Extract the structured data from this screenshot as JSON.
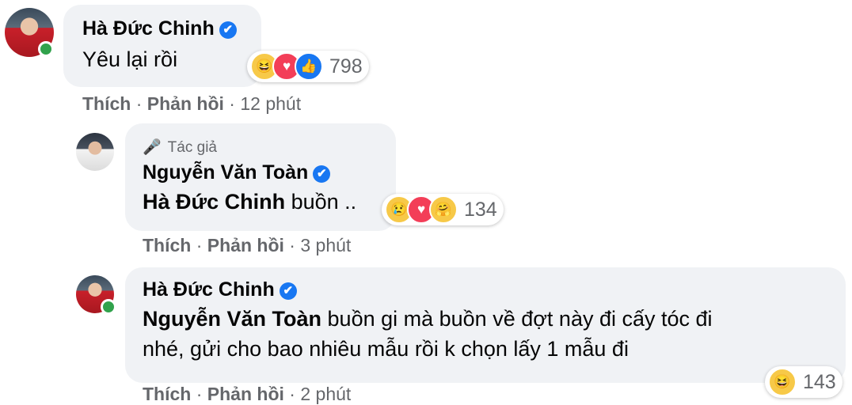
{
  "comments": [
    {
      "name": "Hà Đức Chinh",
      "verified_icon": "✔",
      "text": "Yêu lại rồi",
      "reactions": [
        "haha-icon",
        "love-icon",
        "like-icon"
      ],
      "reaction_count": "798",
      "like": "Thích",
      "reply": "Phản hồi",
      "time": "12 phút"
    },
    {
      "author_badge": "Tác giả",
      "name": "Nguyễn Văn Toàn",
      "verified_icon": "✔",
      "mention": "Hà Đức Chinh",
      "text": " buồn ..",
      "reactions": [
        "sad-icon",
        "love-icon",
        "care-icon"
      ],
      "reaction_count": "134",
      "like": "Thích",
      "reply": "Phản hồi",
      "time": "3 phút"
    },
    {
      "name": "Hà Đức Chinh",
      "verified_icon": "✔",
      "mention": "Nguyễn Văn Toàn",
      "text_line1": " buồn gi mà buồn về đợt này đi cấy tóc đi",
      "text_line2": "nhé, gửi cho bao nhiêu mẫu rồi k chọn lấy 1 mẫu đi",
      "reactions": [
        "haha-icon"
      ],
      "reaction_count": "143",
      "like": "Thích",
      "reply": "Phản hồi",
      "time": "2 phút"
    }
  ],
  "separator": " · "
}
